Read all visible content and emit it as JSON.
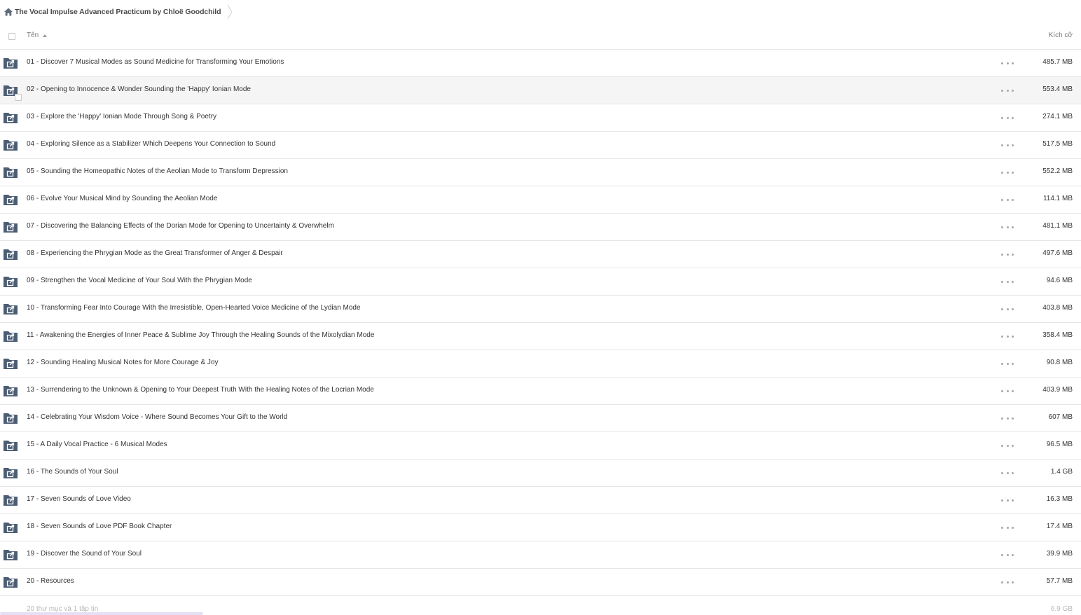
{
  "breadcrumb": {
    "home_icon": "home-icon",
    "folder_title": "The Vocal Impulse Advanced Practicum by Chloë Goodchild",
    "separator_icon": "chevron-right-icon"
  },
  "header": {
    "name_label": "Tên",
    "size_label": "Kích cỡ",
    "sort_icon": "sort-ascending-icon"
  },
  "rows": [
    {
      "name": "01 - Discover 7 Musical Modes as Sound Medicine for Transforming Your Emotions",
      "size": "485.7 MB"
    },
    {
      "name": "02 - Opening to Innocence & Wonder Sounding the 'Happy' Ionian Mode",
      "size": "553.4 MB"
    },
    {
      "name": "03 - Explore the 'Happy' Ionian Mode Through Song & Poetry",
      "size": "274.1 MB"
    },
    {
      "name": "04 - Exploring Silence as a Stabilizer Which Deepens Your Connection to Sound",
      "size": "517.5 MB"
    },
    {
      "name": "05 - Sounding the Homeopathic Notes of the Aeolian Mode to Transform Depression",
      "size": "552.2 MB"
    },
    {
      "name": "06 - Evolve Your Musical Mind by Sounding the Aeolian Mode",
      "size": "114.1 MB"
    },
    {
      "name": "07 - Discovering the Balancing Effects of the Dorian Mode for Opening to Uncertainty & Overwhelm",
      "size": "481.1 MB"
    },
    {
      "name": "08 - Experiencing the Phrygian Mode as the Great Transformer of Anger & Despair",
      "size": "497.6 MB"
    },
    {
      "name": "09 - Strengthen the Vocal Medicine of Your Soul With the Phrygian Mode",
      "size": "94.6 MB"
    },
    {
      "name": "10 - Transforming Fear Into Courage With the Irresistible, Open-Hearted Voice Medicine of the Lydian Mode",
      "size": "403.8 MB"
    },
    {
      "name": "11 - Awakening the Energies of Inner Peace & Sublime Joy Through the Healing Sounds of the Mixolydian Mode",
      "size": "358.4 MB"
    },
    {
      "name": "12 - Sounding Healing Musical Notes for More Courage & Joy",
      "size": "90.8 MB"
    },
    {
      "name": "13 - Surrendering to the Unknown & Opening to Your Deepest Truth With the Healing Notes of the Locrian Mode",
      "size": "403.9 MB"
    },
    {
      "name": "14 - Celebrating Your Wisdom Voice - Where Sound Becomes Your Gift to the World",
      "size": "607 MB"
    },
    {
      "name": "15 - A Daily Vocal Practice - 6 Musical Modes",
      "size": "96.5 MB"
    },
    {
      "name": "16 - The Sounds of Your Soul",
      "size": "1.4 GB"
    },
    {
      "name": "17 - Seven Sounds of Love Video",
      "size": "16.3 MB"
    },
    {
      "name": "18 - Seven Sounds of Love PDF Book Chapter",
      "size": "17.4 MB"
    },
    {
      "name": "19 - Discover the Sound of Your Soul",
      "size": "39.9 MB"
    },
    {
      "name": "20 - Resources",
      "size": "57.7 MB"
    }
  ],
  "hover_row_index": 1,
  "row_icon": "shared-folder-icon",
  "more_icon": "more-horizontal-icon",
  "footer": {
    "summary": "20 thư mục và 1 tập tin",
    "total_size": "6.9 GB"
  },
  "colors": {
    "folder": "#4b5d73",
    "border": "#e6e6e6",
    "hover": "#f5f5f5"
  }
}
